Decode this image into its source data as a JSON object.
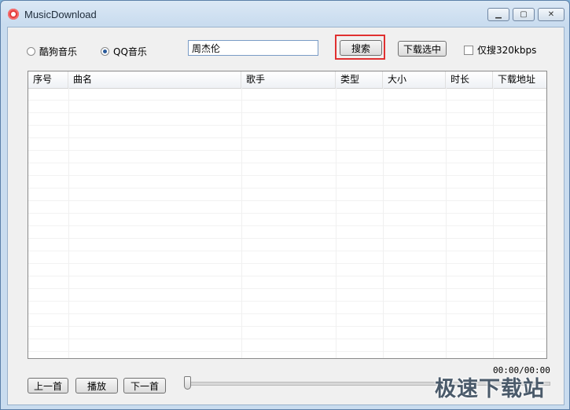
{
  "window": {
    "title": "MusicDownload"
  },
  "source": {
    "options": [
      {
        "label": "酷狗音乐",
        "selected": false
      },
      {
        "label": "QQ音乐",
        "selected": true
      }
    ]
  },
  "search": {
    "value": "周杰伦",
    "button_label": "搜索"
  },
  "toolbar": {
    "download_selected_label": "下载选中",
    "only_320_label": "仅搜320kbps",
    "only_320_checked": false
  },
  "table": {
    "columns": [
      "序号",
      "曲名",
      "歌手",
      "类型",
      "大小",
      "时长",
      "下载地址"
    ],
    "rows": []
  },
  "player": {
    "prev_label": "上一首",
    "play_label": "播放",
    "next_label": "下一首",
    "time": "00:00/00:00",
    "progress": 0
  },
  "watermark": "极速下载站",
  "colors": {
    "highlight": "#e03030"
  }
}
